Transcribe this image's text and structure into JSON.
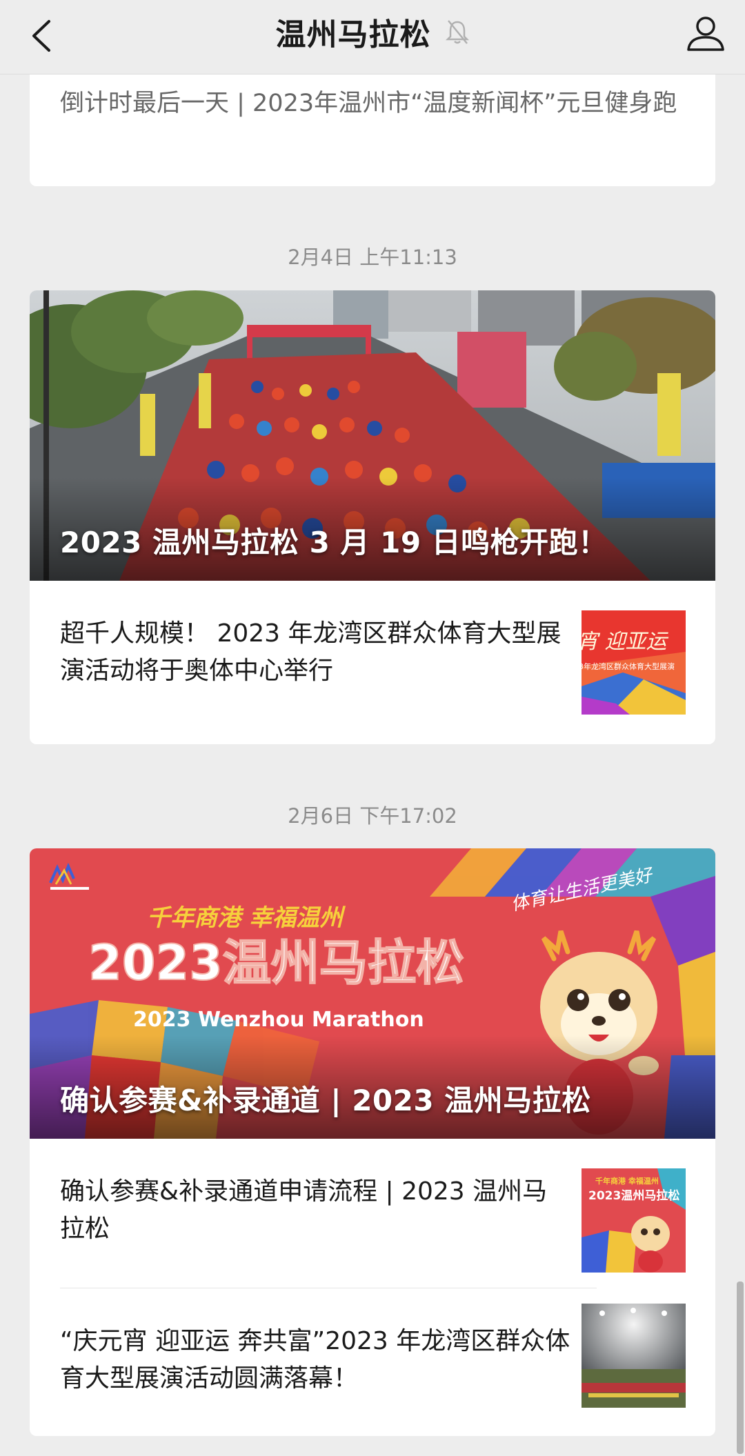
{
  "navbar": {
    "title": "温州马拉松",
    "back_icon": "chevron-left-icon",
    "mute_icon": "bell-off-icon",
    "user_icon": "user-profile-icon"
  },
  "messages": [
    {
      "articles": [
        {
          "title": "倒计时最后一天 | 2023年温州市“温度新闻杯”元旦健身跑"
        }
      ]
    },
    {
      "timestamp": "2月4日 上午11:13",
      "hero": {
        "title": "2023 温州马拉松 3 月 19 日鸣枪开跑！"
      },
      "articles": [
        {
          "title": "超千人规模！ 2023 年龙湾区群众体育大型展演活动将于奥体中心举行"
        }
      ]
    },
    {
      "timestamp": "2月6日 下午17:02",
      "hero": {
        "title": "确认参赛&补录通道 | 2023 温州马拉松",
        "banner_slogan": "千年商港 幸福温州",
        "banner_title": "2023温州马拉松",
        "banner_subtitle": "2023 Wenzhou Marathon",
        "banner_handwriting": "体育让生活更美好"
      },
      "articles": [
        {
          "title": "确认参赛&补录通道申请流程 | 2023 温州马拉松",
          "thumb_top": "千年商港 幸福温州",
          "thumb_mid": "2023温州马拉松"
        },
        {
          "title": "“庆元宵 迎亚运 奔共富”2023 年龙湾区群众体育大型展演活动圆满落幕！"
        }
      ]
    }
  ],
  "thumb1": {
    "text_main": "宵 迎亚运",
    "text_sub": "3年龙湾区群众体育大型展演"
  },
  "colors": {
    "background": "#ededed",
    "card": "#ffffff",
    "banner_red": "#e14a4f",
    "timestamp": "#8b8b8b"
  }
}
